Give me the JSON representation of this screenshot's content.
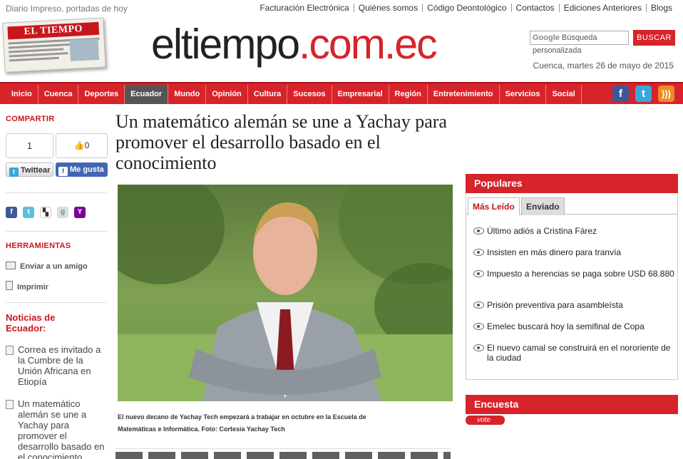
{
  "topbar": {
    "tagline": "Diario Impreso, portadas de hoy",
    "links": [
      "Facturación Electrónica",
      "Quiénes somos",
      "Código Deontológico",
      "Contactos",
      "Ediciones Anteriores",
      "Blogs"
    ]
  },
  "header": {
    "logo_text": "EL TIEMPO",
    "site_name_main": "eltiempo",
    "site_name_domain": ".com.ec",
    "search_brand": "Google",
    "search_placeholder": "Búsqueda personalizada",
    "search_button": "BUSCAR",
    "date": "Cuenca, martes 26 de mayo de 2015"
  },
  "nav": {
    "items": [
      "Inicio",
      "Cuenca",
      "Deportes",
      "Ecuador",
      "Mundo",
      "Opinión",
      "Cultura",
      "Sucesos",
      "Empresarial",
      "Región",
      "Entretenimiento",
      "Servicios",
      "Social"
    ],
    "active": "Ecuador",
    "social_icons": [
      "facebook-icon",
      "twitter-icon",
      "rss-icon"
    ]
  },
  "share": {
    "title": "COMPARTIR",
    "twitter_count": "1",
    "facebook_count": "0",
    "twitter_label": "Twittear",
    "facebook_label": "Me gusta"
  },
  "tools": {
    "title": "HERRAMIENTAS",
    "send_label": "Enviar a un amigo",
    "print_label": "Imprimir"
  },
  "section_news": {
    "title": "Noticias de Ecuador:",
    "items": [
      "Correa es invitado a la Cumbre de la Unión Africana en Etiopía",
      "Un matemático alemán se une a Yachay para promover el desarrollo basado en el conocimiento"
    ]
  },
  "article": {
    "headline": "Un matemático alemán se une a Yachay para promover el desarrollo basado en el conocimiento",
    "caption": "El nuevo decano de Yachay Tech empezará a trabajar en octubre en la Escuela de Matemáticas e Informática. Foto: Cortesía Yachay Tech"
  },
  "popular": {
    "title": "Populares",
    "tab_read": "Más Leído",
    "tab_sent": "Enviado",
    "items": [
      "Último adiós a Cristina Fárez",
      "Insisten en más dinero para tranvía",
      "Impuesto a herencias se paga sobre USD 68.880",
      "Prisión preventiva para asambleísta",
      "Emelec buscará hoy la semifinal de Copa",
      "El nuevo camal se construirá en el nororiente de la ciudad"
    ]
  },
  "poll": {
    "title": "Encuesta",
    "vote_label": "vote"
  },
  "colors": {
    "brand_red": "#d7232a",
    "active_nav": "#555555",
    "facebook": "#3b5998",
    "twitter": "#38a8d9"
  }
}
